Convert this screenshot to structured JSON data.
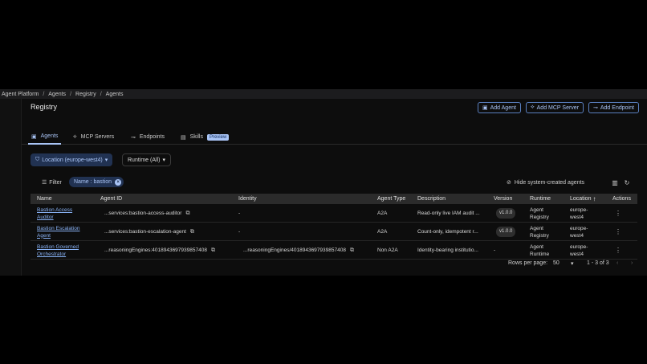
{
  "breadcrumb": [
    "Agent Platform",
    "Agents",
    "Registry",
    "Agents"
  ],
  "page": {
    "title": "Registry",
    "buttons": {
      "add_agent": "Add Agent",
      "add_mcp_server": "Add MCP Server",
      "add_endpoint": "Add Endpoint"
    }
  },
  "tabs": [
    {
      "label": "Agents",
      "icon": "agent-icon",
      "active": true
    },
    {
      "label": "MCP Servers",
      "icon": "mcp-icon",
      "active": false
    },
    {
      "label": "Endpoints",
      "icon": "endpoint-icon",
      "active": false
    },
    {
      "label": "Skills",
      "icon": "skills-icon",
      "active": false,
      "badge": "Preview"
    }
  ],
  "filters": {
    "location": "Location (europe-west4)",
    "runtime": "Runtime (All)",
    "filter_label": "Filter",
    "name_chip": "Name : bastion",
    "hide_system": "Hide system-created agents"
  },
  "table": {
    "columns": [
      "Name",
      "Agent ID",
      "Identity",
      "Agent Type",
      "Description",
      "Version",
      "Runtime",
      "Location",
      "Actions"
    ],
    "rows": [
      {
        "name_line1": "Bastion Access",
        "name_line2": "Auditor",
        "agent_id": "...services:bastion-access-auditor",
        "identity": "-",
        "agent_type": "A2A",
        "description": "Read-only live IAM audit ...",
        "version": "v1.0.0",
        "runtime_line1": "Agent",
        "runtime_line2": "Registry",
        "location_line1": "europe-",
        "location_line2": "west4"
      },
      {
        "name_line1": "Bastion Escalation",
        "name_line2": "Agent",
        "agent_id": "...services:bastion-escalation-agent",
        "identity": "-",
        "agent_type": "A2A",
        "description": "Count-only, idempotent r...",
        "version": "v1.0.0",
        "runtime_line1": "Agent",
        "runtime_line2": "Registry",
        "location_line1": "europe-",
        "location_line2": "west4"
      },
      {
        "name_line1": "Bastion Governed",
        "name_line2": "Orchestrator",
        "agent_id": "...reasoningEngines:4018943697939857408",
        "identity": "...reasoningEngines/4018943697939857408",
        "agent_type": "Non A2A",
        "description": "Identity-bearing institutio...",
        "version": "-",
        "runtime_line1": "Agent",
        "runtime_line2": "Runtime",
        "location_line1": "europe-",
        "location_line2": "west4"
      }
    ]
  },
  "pagination": {
    "rows_per_page_label": "Rows per page:",
    "rows_per_page": "50",
    "range": "1 - 3 of 3"
  },
  "colors": {
    "accent": "#a9c4f5",
    "link": "#8ab4f8",
    "chip_bg": "#213252"
  }
}
